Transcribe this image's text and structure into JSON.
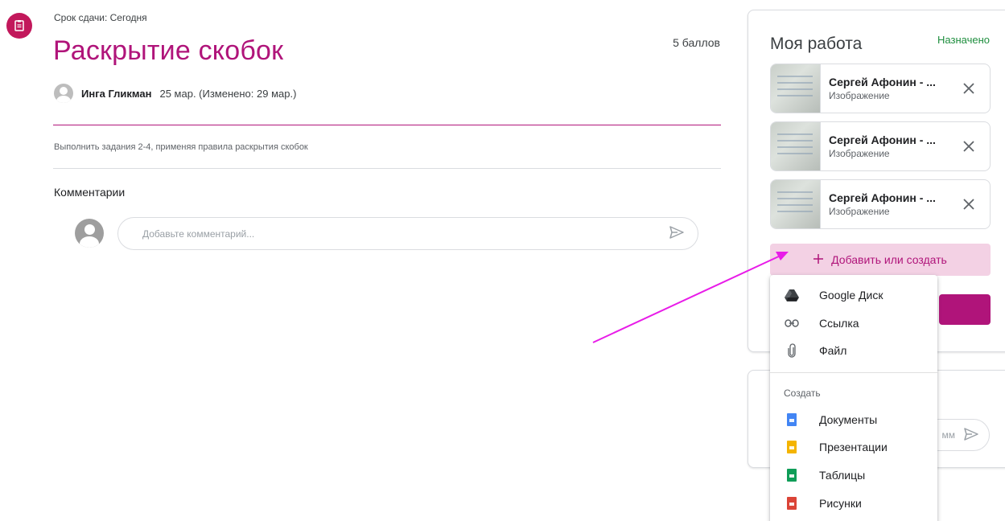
{
  "assignment": {
    "due": "Срок сдачи: Сегодня",
    "title": "Раскрытие скобок",
    "points": "5 баллов",
    "author": "Инга Гликман",
    "date": "25 мар. (Изменено: 29 мар.)",
    "description": "Выполнить задания 2-4, применяя правила раскрытия скобок"
  },
  "comments": {
    "heading": "Комментарии",
    "placeholder": "Добавьте комментарий..."
  },
  "my_work": {
    "title": "Моя работа",
    "status": "Назначено",
    "attachments": [
      {
        "name": "Сергей Афонин - ...",
        "type": "Изображение"
      },
      {
        "name": "Сергей Афонин - ...",
        "type": "Изображение"
      },
      {
        "name": "Сергей Афонин - ...",
        "type": "Изображение"
      }
    ],
    "add_label": "Добавить или создать"
  },
  "private_comments": {
    "placeholder_fragment": "мм"
  },
  "add_menu": {
    "items": [
      {
        "label": "Google Диск",
        "icon": "google-drive-icon"
      },
      {
        "label": "Ссылка",
        "icon": "link-icon"
      },
      {
        "label": "Файл",
        "icon": "attachment-icon"
      }
    ],
    "create_heading": "Создать",
    "create_items": [
      {
        "label": "Документы",
        "icon": "google-docs-icon",
        "color": "#4285f4"
      },
      {
        "label": "Презентации",
        "icon": "google-slides-icon",
        "color": "#f4b400"
      },
      {
        "label": "Таблицы",
        "icon": "google-sheets-icon",
        "color": "#0f9d58"
      },
      {
        "label": "Рисунки",
        "icon": "google-drawings-icon",
        "color": "#db4437"
      }
    ]
  },
  "colors": {
    "accent": "#b0147a",
    "status_green": "#1e8e3e",
    "annotation_arrow": "#e81ce8"
  }
}
